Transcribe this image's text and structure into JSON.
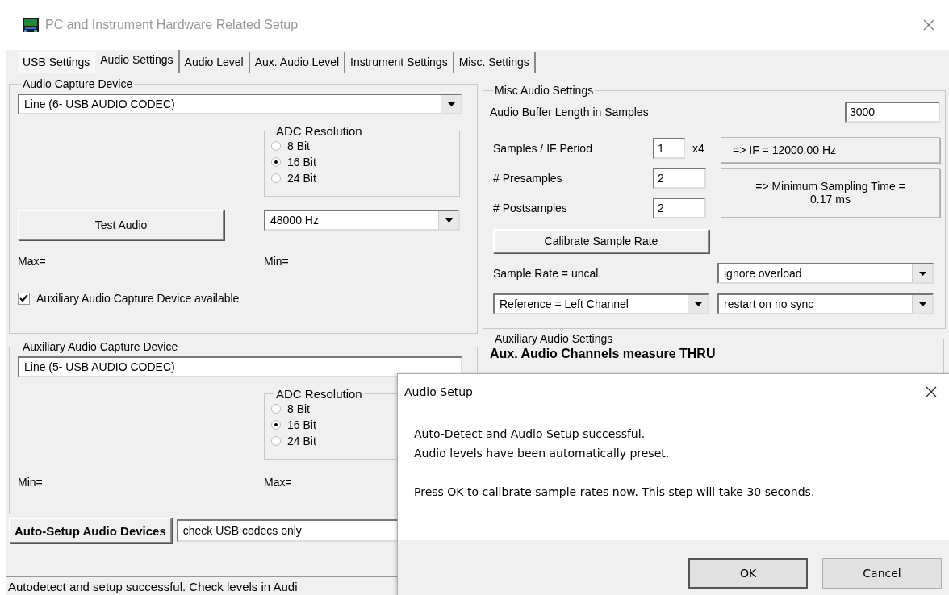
{
  "window": {
    "title": "PC and Instrument Hardware Related Setup"
  },
  "tabs": [
    {
      "label": "USB Settings",
      "selected": false
    },
    {
      "label": "Audio Settings",
      "selected": true
    },
    {
      "label": "Audio Level",
      "selected": false
    },
    {
      "label": "Aux. Audio Level",
      "selected": false
    },
    {
      "label": "Instrument Settings",
      "selected": false
    },
    {
      "label": "Misc. Settings",
      "selected": false
    }
  ],
  "audio_capture": {
    "title": "Audio Capture Device",
    "device": "Line (6- USB AUDIO  CODEC)",
    "adc": {
      "title": "ADC Resolution",
      "options": [
        {
          "label": "8 Bit",
          "selected": false
        },
        {
          "label": "16 Bit",
          "selected": true
        },
        {
          "label": "24 Bit",
          "selected": false
        }
      ]
    },
    "test_button": "Test Audio",
    "sample_rate": "48000 Hz",
    "left_reading": "Max=",
    "right_reading": "Min=",
    "aux_checkbox": {
      "label": "Auxiliary Audio Capture Device available",
      "checked": true
    }
  },
  "aux_capture": {
    "title": "Auxiliary Audio Capture Device",
    "device": "Line (5- USB AUDIO  CODEC)",
    "adc": {
      "title": "ADC Resolution",
      "options": [
        {
          "label": "8 Bit",
          "selected": false
        },
        {
          "label": "16 Bit",
          "selected": true
        },
        {
          "label": "24 Bit",
          "selected": false
        }
      ]
    },
    "left_reading": "Min=",
    "right_reading": "Max="
  },
  "auto_setup": {
    "button": "Auto-Setup Audio Devices",
    "select": "check USB codecs only"
  },
  "misc_audio": {
    "title": "Misc Audio Settings",
    "buffer_label": "Audio Buffer Length in Samples",
    "buffer_value": "3000",
    "samples_label": "Samples / IF Period",
    "samples_value": "1",
    "multiplier": "x4",
    "if_readout": "=> IF =   12000.00 Hz",
    "presamples_label": "# Presamples",
    "presamples_value": "2",
    "postsamples_label": "# Postsamples",
    "postsamples_value": "2",
    "min_time": "=> Minimum Sampling Time =\n0.17 ms",
    "calibrate_button": "Calibrate Sample Rate",
    "sample_rate_status": "Sample Rate = uncal.",
    "overload_select": "ignore overload",
    "reference_select": "Reference = Left Channel",
    "sync_select": "restart on no sync"
  },
  "aux_settings": {
    "title": "Auxiliary Audio Settings",
    "heading": "Aux. Audio Channels measure THRU"
  },
  "status_bar": "Autodetect and setup successful. Check levels in Audi",
  "dialog": {
    "title": "Audio Setup",
    "paragraphs": [
      "Auto-Detect and Audio Setup successful.\nAudio levels have been automatically preset.",
      "Press OK to calibrate sample rates now. This step will take 30 seconds."
    ],
    "buttons": [
      "OK",
      "Cancel"
    ]
  }
}
